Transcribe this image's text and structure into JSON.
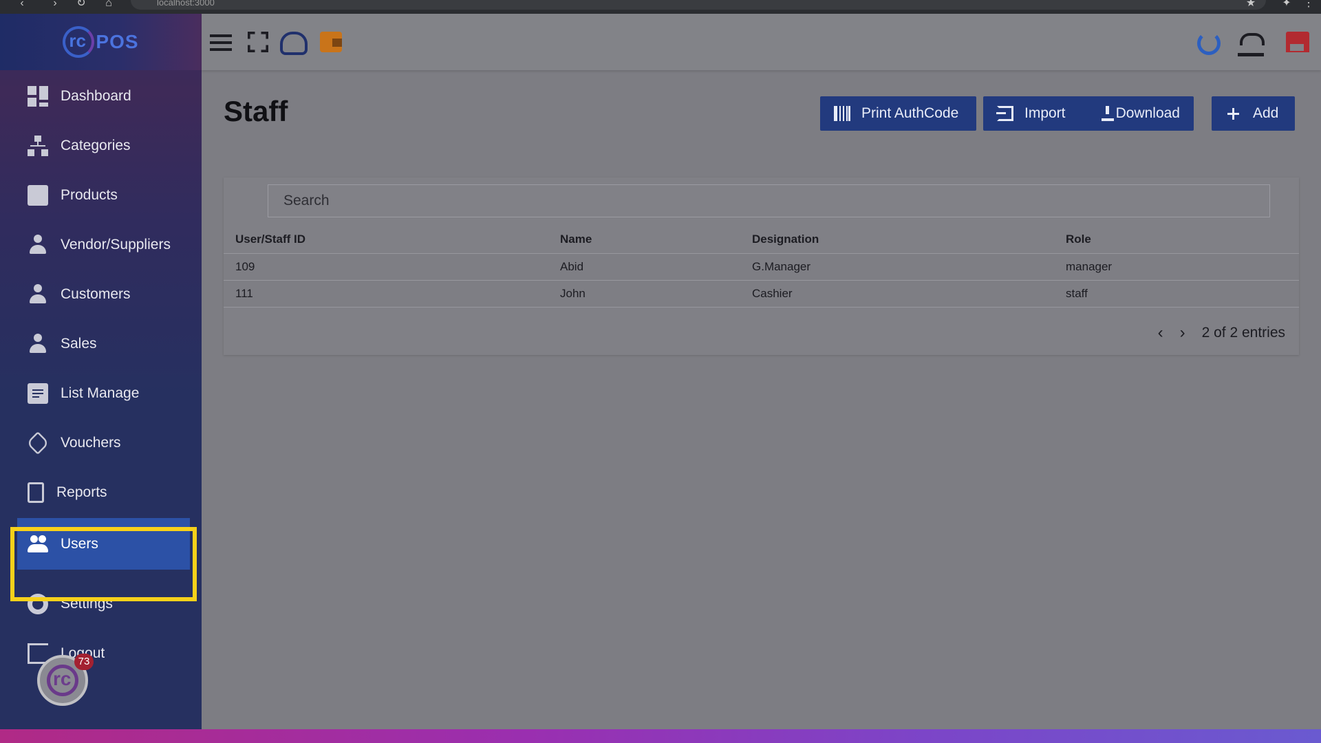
{
  "browser": {
    "url": "localhost:3000"
  },
  "brand": {
    "logo_text": "POS"
  },
  "sidebar": {
    "items": [
      {
        "label": "Dashboard",
        "icon": "dashboard-icon"
      },
      {
        "label": "Categories",
        "icon": "sitemap-icon"
      },
      {
        "label": "Products",
        "icon": "box-icon"
      },
      {
        "label": "Vendor/Suppliers",
        "icon": "person-icon"
      },
      {
        "label": "Customers",
        "icon": "person-icon"
      },
      {
        "label": "Sales",
        "icon": "person-icon"
      },
      {
        "label": "List Manage",
        "icon": "clipboard-icon"
      },
      {
        "label": "Vouchers",
        "icon": "tag-icon"
      },
      {
        "label": "Reports",
        "icon": "document-icon"
      },
      {
        "label": "Users",
        "icon": "users-icon",
        "active": true
      },
      {
        "label": "Settings",
        "icon": "gear-icon"
      },
      {
        "label": "Logout",
        "icon": "logout-icon"
      }
    ],
    "notification_badge": "73"
  },
  "topbar": {
    "left_icons": [
      "hamburger-icon",
      "fullscreen-icon",
      "cloud-print-icon",
      "wallet-icon"
    ],
    "right_icons": [
      "refresh-icon",
      "scale-icon",
      "store-icon"
    ]
  },
  "page": {
    "title": "Staff",
    "buttons": {
      "print_authcode": "Print AuthCode",
      "import": "Import",
      "download": "Download",
      "add": "Add"
    },
    "search": {
      "placeholder": "Search"
    },
    "table": {
      "columns": [
        "User/Staff ID",
        "Name",
        "Designation",
        "Role"
      ],
      "rows": [
        [
          "109",
          "Abid",
          "G.Manager",
          "manager"
        ],
        [
          "111",
          "John",
          "Cashier",
          "staff"
        ]
      ]
    },
    "pagination": {
      "summary": "2 of 2 entries"
    }
  },
  "colors": {
    "sidebar_bg": "#263060",
    "active_item": "#2c51a6",
    "highlight_outline": "#f7d11a",
    "button_bg": "#223a7e",
    "content_bg": "#7d7d83"
  }
}
